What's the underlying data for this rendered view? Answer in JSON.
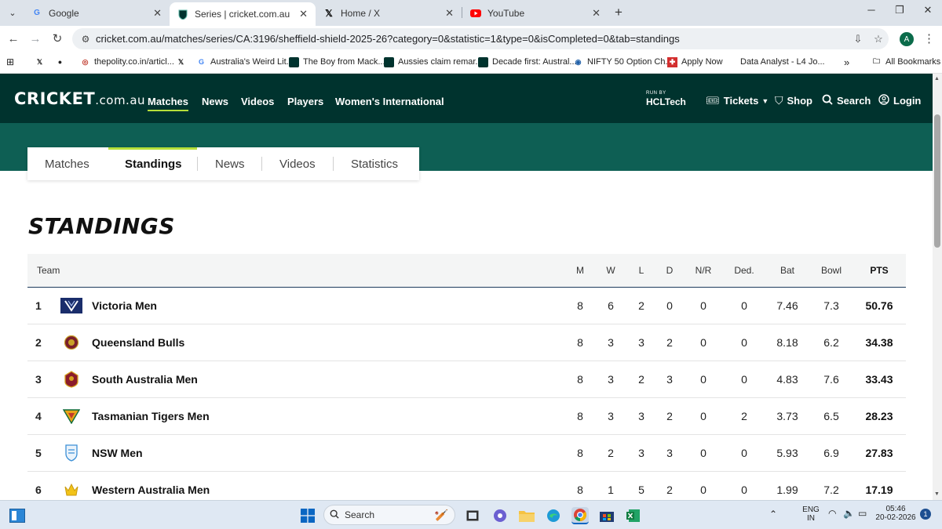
{
  "browser": {
    "tabs": [
      {
        "title": "Google",
        "active": false
      },
      {
        "title": "Series | cricket.com.au",
        "active": true
      },
      {
        "title": "Home / X",
        "active": false
      },
      {
        "title": "YouTube",
        "active": false
      }
    ],
    "url": "cricket.com.au/matches/series/CA:3196/sheffield-shield-2025-26?category=0&statistic=1&type=0&isCompleted=0&tab=standings",
    "profile_initial": "A"
  },
  "bookmarks": {
    "items": [
      "thepolity.co.in/articl...",
      "Australia's Weird Lit...",
      "The Boy from Mack...",
      "Aussies claim remar...",
      "Decade first: Austral...",
      "NIFTY 50 Option Ch...",
      "Apply Now",
      "Data Analyst - L4 Jo..."
    ],
    "more": "»",
    "all_bookmarks": "All Bookmarks"
  },
  "site": {
    "logo_main": "CRICKET",
    "logo_domain": ".com.au",
    "nav": [
      "Matches",
      "News",
      "Videos",
      "Players",
      "Women's International"
    ],
    "run_by_small": "RUN BY",
    "run_by_brand": "HCLTech",
    "tickets": "Tickets",
    "shop": "Shop",
    "search": "Search",
    "login": "Login",
    "accent_color": "#b5df3a",
    "header_color": "#00332e"
  },
  "subnav": {
    "tabs": [
      "Matches",
      "Standings",
      "News",
      "Videos",
      "Statistics"
    ],
    "active": "Standings"
  },
  "standings": {
    "heading": "STANDINGS",
    "columns": {
      "team": "Team",
      "m": "M",
      "w": "W",
      "l": "L",
      "d": "D",
      "nr": "N/R",
      "ded": "Ded.",
      "bat": "Bat",
      "bowl": "Bowl",
      "pts": "PTS"
    },
    "rows": [
      {
        "rank": "1",
        "team": "Victoria Men",
        "m": "8",
        "w": "6",
        "l": "2",
        "d": "0",
        "nr": "0",
        "ded": "0",
        "bat": "7.46",
        "bowl": "7.3",
        "pts": "50.76"
      },
      {
        "rank": "2",
        "team": "Queensland Bulls",
        "m": "8",
        "w": "3",
        "l": "3",
        "d": "2",
        "nr": "0",
        "ded": "0",
        "bat": "8.18",
        "bowl": "6.2",
        "pts": "34.38"
      },
      {
        "rank": "3",
        "team": "South Australia Men",
        "m": "8",
        "w": "3",
        "l": "2",
        "d": "3",
        "nr": "0",
        "ded": "0",
        "bat": "4.83",
        "bowl": "7.6",
        "pts": "33.43"
      },
      {
        "rank": "4",
        "team": "Tasmanian Tigers Men",
        "m": "8",
        "w": "3",
        "l": "3",
        "d": "2",
        "nr": "0",
        "ded": "2",
        "bat": "3.73",
        "bowl": "6.5",
        "pts": "28.23"
      },
      {
        "rank": "5",
        "team": "NSW Men",
        "m": "8",
        "w": "2",
        "l": "3",
        "d": "3",
        "nr": "0",
        "ded": "0",
        "bat": "5.93",
        "bowl": "6.9",
        "pts": "27.83"
      },
      {
        "rank": "6",
        "team": "Western Australia Men",
        "m": "8",
        "w": "1",
        "l": "5",
        "d": "2",
        "nr": "0",
        "ded": "0",
        "bat": "1.99",
        "bowl": "7.2",
        "pts": "17.19"
      }
    ]
  },
  "taskbar": {
    "search_label": "Search",
    "lang": "ENG",
    "region": "IN",
    "time": "05:46",
    "date": "20-02-2026",
    "notification_count": "1"
  }
}
